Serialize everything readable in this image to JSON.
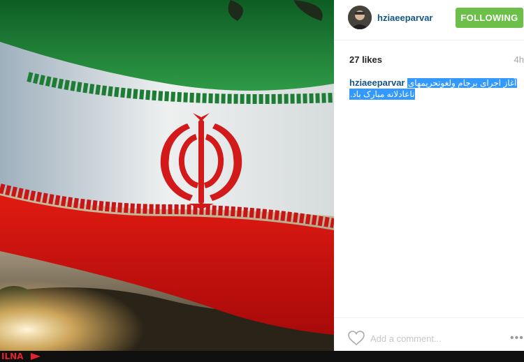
{
  "post": {
    "username": "hziaeeparvar",
    "follow_label": "FOLLOWING",
    "likes": "27 likes",
    "time": "4h",
    "caption_user": "hziaeeparvar",
    "caption_line1": "آغاز اجرای برجام ولغوتحریمهای",
    "caption_line2": "ناعادلانه مبارک باد.",
    "comment_placeholder": "Add a comment...",
    "more_label": "•••"
  },
  "colors": {
    "link": "#125688",
    "follow_green": "#6cc04a",
    "selection": "#3399ff",
    "flag_green": "#239f40",
    "flag_red": "#da0000"
  },
  "watermark": {
    "label": "ILNA"
  }
}
